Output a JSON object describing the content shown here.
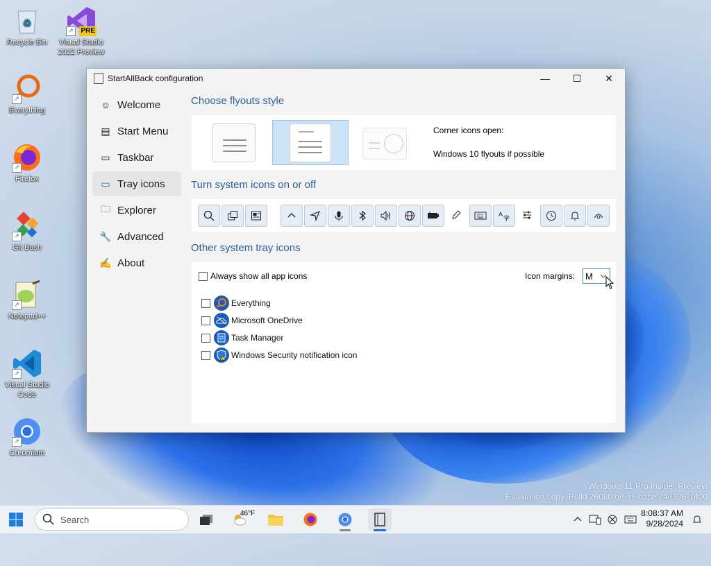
{
  "desktop": {
    "icons": [
      {
        "label_l1": "Recycle Bin",
        "label_l2": ""
      },
      {
        "label_l1": "Visual Studio",
        "label_l2": "2022 Preview",
        "badge": "PRE"
      },
      {
        "label_l1": "Everything",
        "label_l2": ""
      },
      {
        "label_l1": "Firefox",
        "label_l2": ""
      },
      {
        "label_l1": "Git Bash",
        "label_l2": ""
      },
      {
        "label_l1": "Notepad++",
        "label_l2": ""
      },
      {
        "label_l1": "Visual Studio",
        "label_l2": "Code"
      },
      {
        "label_l1": "Chromium",
        "label_l2": ""
      }
    ],
    "watermark_l1": "Windows 11 Pro Insider Preview",
    "watermark_l2": "Evaluation copy. Build 26080.ge_release.240308-1400"
  },
  "window": {
    "title": "StartAllBack configuration",
    "controls": {
      "minimize": "—",
      "maximize": "☐",
      "close": "✕"
    },
    "nav": [
      {
        "label": "Welcome",
        "icon": "smile-icon",
        "glyph": "☺"
      },
      {
        "label": "Start Menu",
        "icon": "start-menu-icon",
        "glyph": "▤"
      },
      {
        "label": "Taskbar",
        "icon": "taskbar-icon",
        "glyph": "▭"
      },
      {
        "label": "Tray icons",
        "icon": "tray-icon",
        "glyph": "▭"
      },
      {
        "label": "Explorer",
        "icon": "folder-icon",
        "glyph": "🗀"
      },
      {
        "label": "Advanced",
        "icon": "wrench-icon",
        "glyph": "🔧"
      },
      {
        "label": "About",
        "icon": "signature-icon",
        "glyph": "✍"
      }
    ],
    "active_nav": "Tray icons",
    "sections": {
      "flyouts_title": "Choose flyouts style",
      "corner_label": "Corner icons open:",
      "corner_value": "Windows 10 flyouts if possible",
      "system_icons_title": "Turn system icons on or off",
      "other_title": "Other system tray icons",
      "always_show_label": "Always show all app icons",
      "icon_margins_label": "Icon margins:",
      "icon_margins_value": "M",
      "apps": [
        {
          "label": "Everything",
          "icon": "everything-icon"
        },
        {
          "label": "Microsoft OneDrive",
          "icon": "onedrive-icon"
        },
        {
          "label": "Task Manager",
          "icon": "task-manager-icon"
        },
        {
          "label": "Windows Security notification icon",
          "icon": "windows-security-icon"
        }
      ]
    },
    "system_icons": [
      {
        "name": "search-icon",
        "glyph": "⌕"
      },
      {
        "name": "task-view-icon",
        "glyph": "⧉"
      },
      {
        "name": "widgets-icon",
        "glyph": "▦"
      },
      {
        "name": "chevron-up-icon",
        "glyph": "^"
      },
      {
        "name": "location-icon",
        "glyph": "➤"
      },
      {
        "name": "microphone-icon",
        "glyph": "🎙"
      },
      {
        "name": "bluetooth-icon",
        "glyph": "ᛒ"
      },
      {
        "name": "volume-icon",
        "glyph": "🔊"
      },
      {
        "name": "globe-icon",
        "glyph": "🌐"
      },
      {
        "name": "battery-icon",
        "glyph": "▰"
      },
      {
        "name": "pen-icon",
        "glyph": "✎"
      },
      {
        "name": "keyboard-icon",
        "glyph": "⌨"
      },
      {
        "name": "language-icon",
        "glyph": "あ"
      },
      {
        "name": "sliders-icon",
        "glyph": "☰"
      },
      {
        "name": "clock-icon",
        "glyph": "◷"
      },
      {
        "name": "bell-icon",
        "glyph": "🔔"
      },
      {
        "name": "eye-icon",
        "glyph": "◉"
      }
    ]
  },
  "taskbar": {
    "search_placeholder": "Search",
    "weather": "46°F",
    "time": "8:08:37 AM",
    "date": "9/28/2024"
  }
}
